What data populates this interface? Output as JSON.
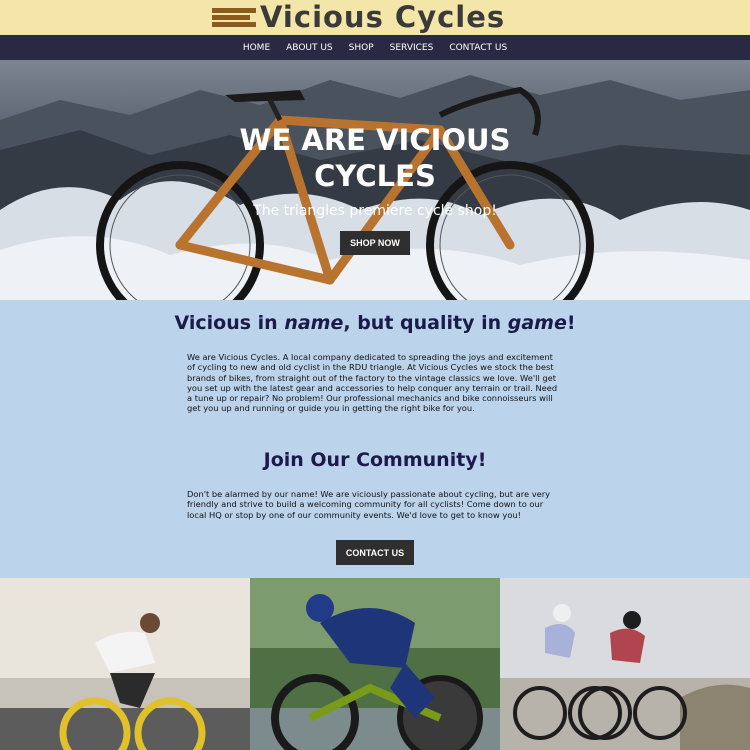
{
  "header": {
    "logo_text": "Vicious Cycles",
    "brand_colors": {
      "header_bg": "#f4e6a9",
      "nav_bg": "#2a2944",
      "page_bg": "#bcd3ec",
      "heading": "#1b1a4b"
    }
  },
  "nav": {
    "items": [
      {
        "label": "HOME"
      },
      {
        "label": "ABOUT US"
      },
      {
        "label": "SHOP"
      },
      {
        "label": "SERVICES"
      },
      {
        "label": "CONTACT US"
      }
    ]
  },
  "hero": {
    "title": "WE ARE VICIOUS CYCLES",
    "subtitle": "The triangles premiere cycle shop!",
    "button_label": "SHOP NOW"
  },
  "about": {
    "heading_parts": [
      "Vicious in ",
      "name",
      ", but quality in ",
      "game",
      "!"
    ],
    "paragraph": "We are Vicious Cycles. A local company dedicated to spreading the joys and excitement of cycling to new and old cyclist in the RDU triangle. At Vicious Cycles we stock the best brands of bikes, from straight out of the factory to the vintage classics we love. We'll get you set up with the latest gear and accessories to help conquer any terrain or trail. Need a tune up or repair? No problem! Our professional mechanics and bike connoisseurs will get you up and running or guide you in getting the right bike for you."
  },
  "community": {
    "heading": "Join Our Community!",
    "paragraph": "Don't be alarmed by our name! We are viciously passionate about cycling, but are very friendly and strive to build a welcoming community for all cyclists! Come down to our local HQ or stop by one of our community events. We'd love to get to know you!",
    "button_label": "CONTACT US"
  },
  "photos": [
    {
      "icon": "cyclist-photo-yellow-bike"
    },
    {
      "icon": "cyclist-photo-racer"
    },
    {
      "icon": "cyclist-photo-two-riders"
    }
  ]
}
